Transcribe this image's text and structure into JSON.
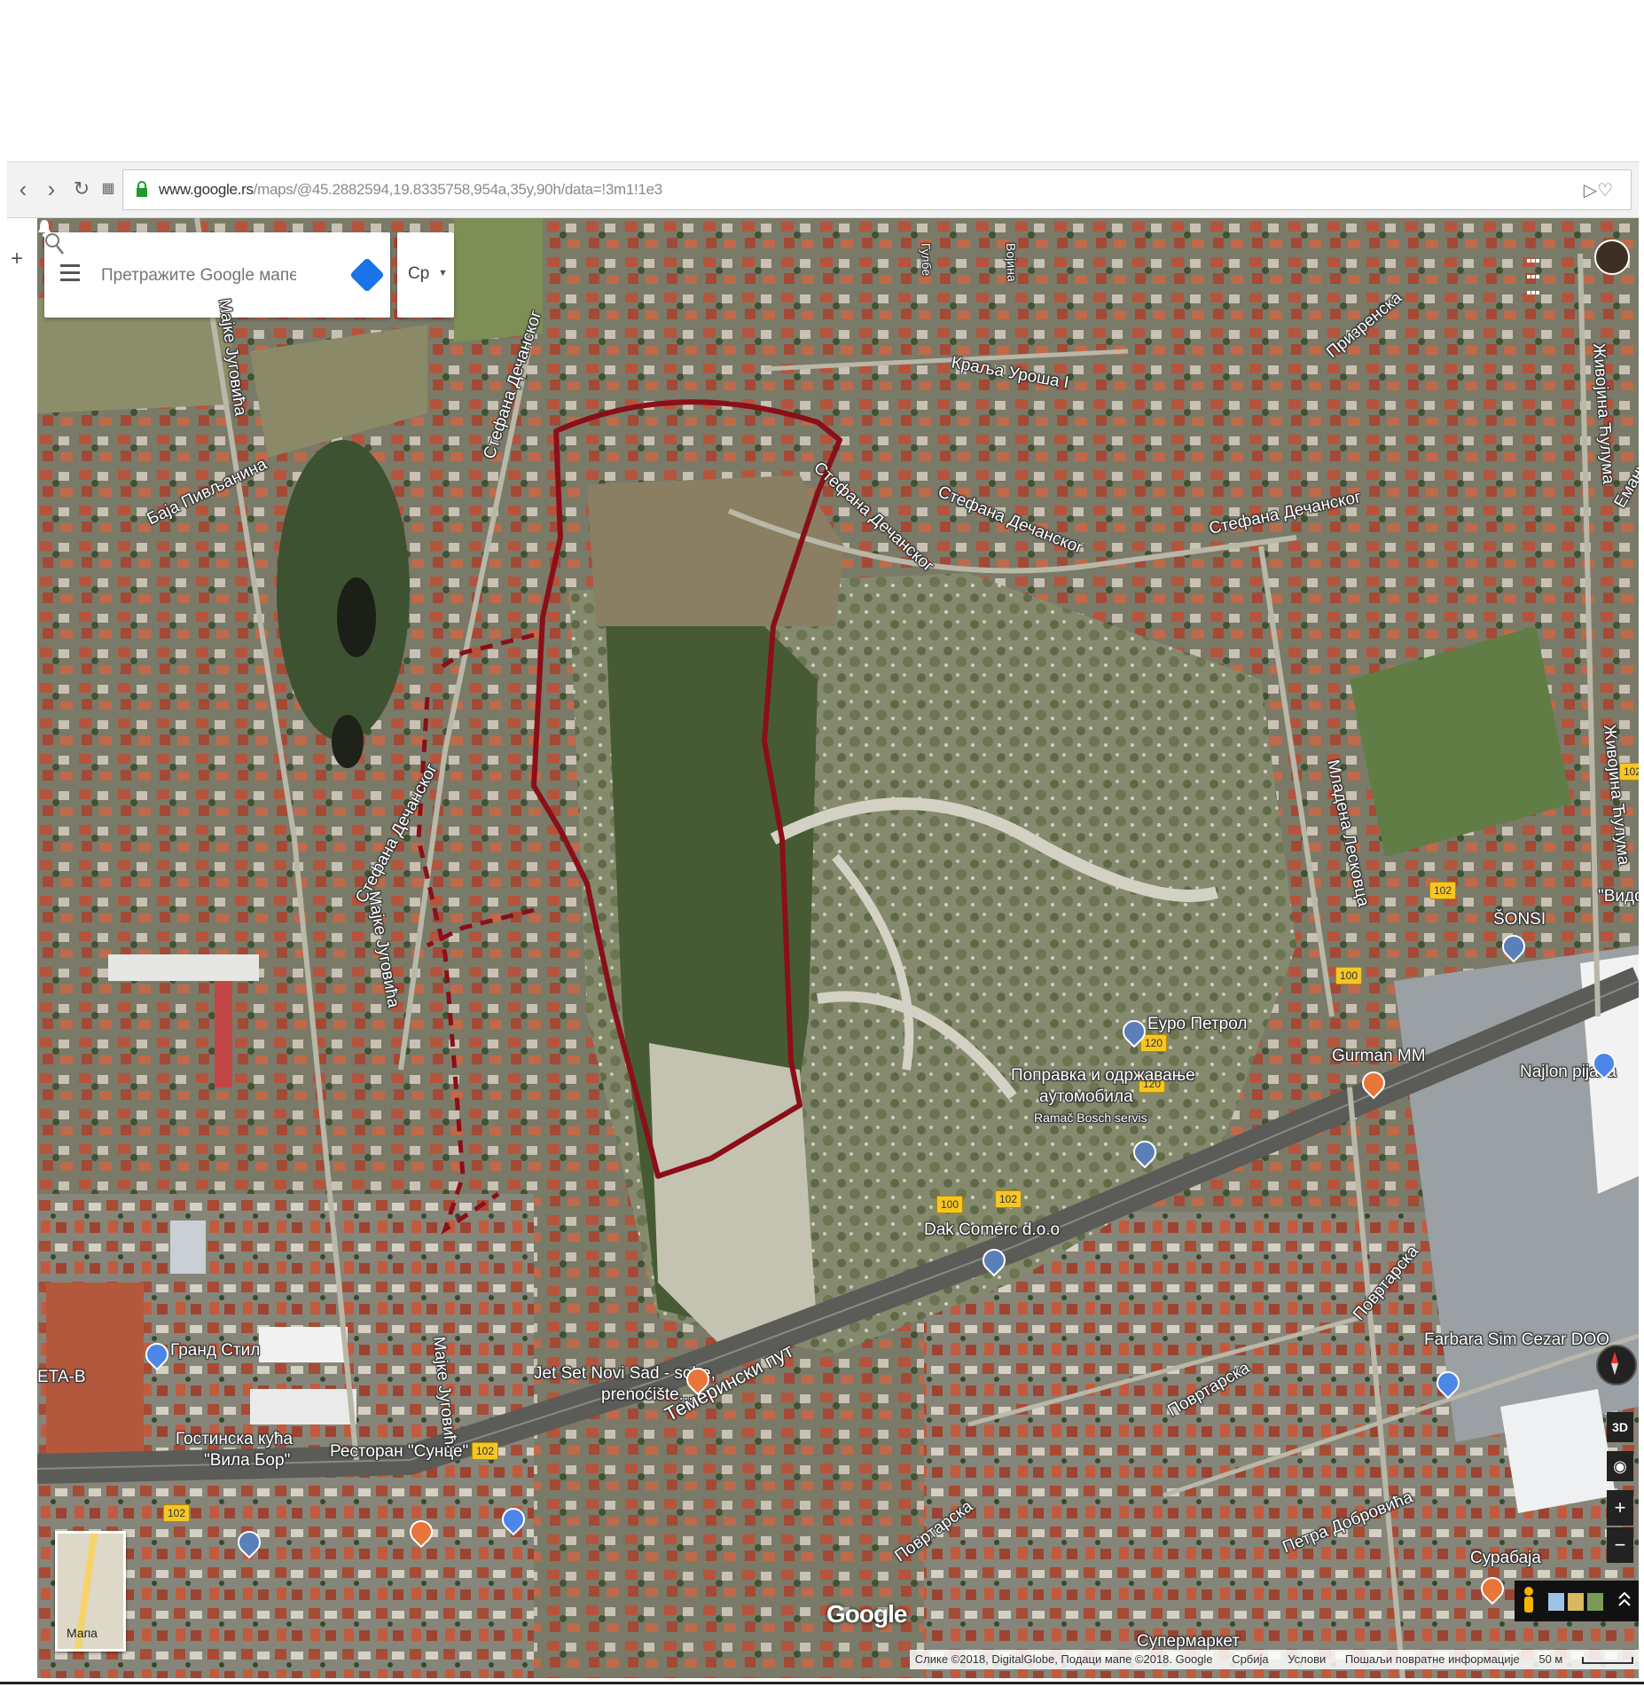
{
  "browser": {
    "url_host": "www.google.rs",
    "url_path": "/maps/@45.2882594,19.8335758,954a,35y,90h/data=!3m1!1e3",
    "new_tab_symbol": "+"
  },
  "map": {
    "search_placeholder": "Претражите Google мапе",
    "language": "Ср",
    "minimap_label": "Мапа",
    "google_logo": "Google",
    "controls": {
      "three_d": "3D",
      "zoom_in": "+",
      "zoom_out": "−"
    },
    "attribution": [
      "Слике ©2018, DigitalGlobe, Подаци мапе ©2018. Google",
      "Србија",
      "Услови",
      "Пошаљи повратне информације",
      "50 м"
    ],
    "streets": {
      "baja_pivljanina": "Баја Пивљанина",
      "majke_jugovica_1": "Мајке Југовића",
      "majke_jugovica_2": "Мајке Југовића",
      "majke_jugovica_3": "Мајке Југовића",
      "stefana_decanskog_1": "Стефана Дечанског",
      "stefana_decanskog_2": "Стефана Дечанског",
      "stefana_decanskog_3": "Стефана Дечанског",
      "stefana_decanskog_4": "Стефана Дечанског",
      "stefana_decanskog_5": "Стефана Дечанског",
      "kralja_urosa": "Краља Уроша I",
      "prizrenska": "Призренска",
      "zivojina_cuculma_1": "Живојина Ћулума",
      "zivojina_cuculma_2": "Живојина Ћулума",
      "mladena_leskovca": "Младена Лесковца",
      "temerinski_put": "Темерински пут",
      "povrtarska_1": "Повртарска",
      "povrtarska_2": "Повртарска",
      "povrtarska_3": "Повртарска",
      "petra_dobrovica": "Петра Добровића",
      "emanuela": "Еману",
      "gulbe": "Гулбе",
      "vojina": "Војина"
    },
    "places": {
      "euro_petrol": "Еуро Петрол",
      "popravka_1": "Поправка и одржавање",
      "popravka_2": "аутомобила",
      "ramac": "Ramač Bosch servis",
      "gurman": "Gurman MM",
      "najlon": "Najlon pijaca",
      "sonsi": "ŠONSI",
      "vidov": "\"Видов",
      "dak": "Dak Comerc d.o.o",
      "jetset_1": "Jet Set Novi Sad - sobe,",
      "jetset_2": "prenoćište...",
      "grand_stil": "Гранд Стил",
      "eta_b": "ETA-B",
      "gostinska_1": "Гостинска кућа",
      "gostinska_2": "\"Вила Бор\"",
      "restoran_1": "Ресторан \"Сунце\"",
      "farbara": "Farbara Sim Cezar DOO",
      "surabaja": "Сурабаја",
      "supermarket": "Супермаркет"
    },
    "road_numbers": [
      "102",
      "102",
      "100",
      "120",
      "120",
      "100",
      "102",
      "102",
      "102",
      "102"
    ],
    "colors": {
      "outline": "#8b0f18",
      "shield": "#f6c624"
    }
  }
}
